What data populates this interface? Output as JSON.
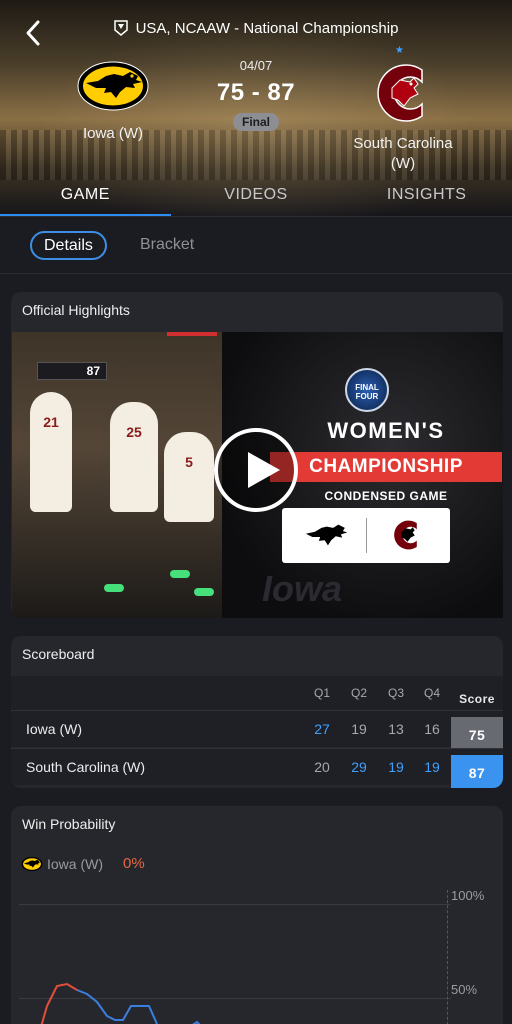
{
  "header": {
    "league_title": "USA, NCAAW - National Championship",
    "date": "04/07",
    "score": "75 - 87",
    "status": "Final",
    "home_team": "Iowa (W)",
    "away_team_line1": "South Carolina",
    "away_team_line2": "(W)",
    "colors": {
      "accent": "#2f8cf0",
      "status_pill": "#8c8e94"
    }
  },
  "tabs": [
    {
      "label": "GAME",
      "active": true
    },
    {
      "label": "VIDEOS",
      "active": false
    },
    {
      "label": "INSIGHTS",
      "active": false
    }
  ],
  "subtabs": [
    {
      "label": "Details",
      "active": true
    },
    {
      "label": "Bracket",
      "active": false
    }
  ],
  "highlights": {
    "title": "Official Highlights",
    "thumbnail": {
      "scoreboard_number": "87",
      "jersey_numbers": [
        "21",
        "25",
        "5"
      ],
      "badge_lines": [
        "FINAL",
        "FOUR"
      ],
      "headline": "WOMEN'S",
      "headline_banner": "CHAMPIONSHIP",
      "subheadline": "CONDENSED GAME",
      "script_text": "Iowa"
    },
    "play_icon": "play-circle-icon"
  },
  "scoreboard": {
    "title": "Scoreboard",
    "columns": [
      "Q1",
      "Q2",
      "Q3",
      "Q4",
      "Score"
    ],
    "rows": [
      {
        "team": "Iowa (W)",
        "q": [
          "27",
          "19",
          "13",
          "16"
        ],
        "score": "75"
      },
      {
        "team": "South Carolina (W)",
        "q": [
          "20",
          "29",
          "19",
          "19"
        ],
        "score": "87"
      }
    ],
    "colors": {
      "winner_blue": "#3ea0ff",
      "loser_score_bg": "#686a72",
      "winner_score_bg": "#3a93ee"
    }
  },
  "win_probability": {
    "title": "Win Probability",
    "team": "Iowa (W)",
    "current": "0%",
    "y_labels": [
      "100%",
      "50%"
    ],
    "colors": {
      "line_up": "#e0503a",
      "line_down": "#3a7fe0",
      "pct": "#e8663e"
    }
  }
}
